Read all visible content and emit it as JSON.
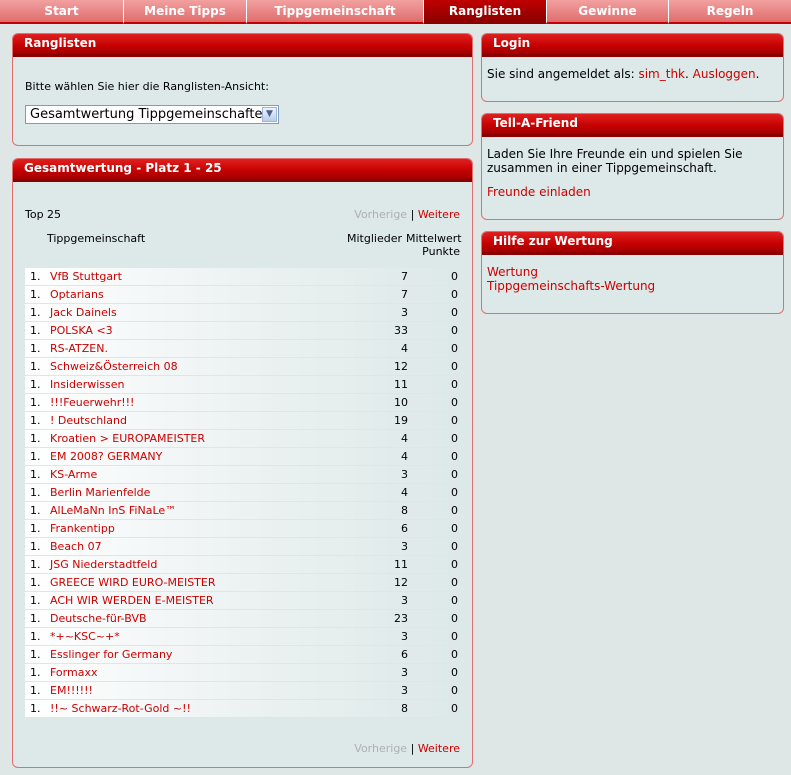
{
  "tabs": [
    {
      "label": "Start"
    },
    {
      "label": "Meine Tipps"
    },
    {
      "label": "Tippgemeinschaft"
    },
    {
      "label": "Ranglisten"
    },
    {
      "label": "Gewinne"
    },
    {
      "label": "Regeln"
    }
  ],
  "ranglisten": {
    "title": "Ranglisten",
    "instruction": "Bitte wählen Sie hier die Ranglisten-Ansicht:",
    "selected_view": "Gesamtwertung Tippgemeinschaften"
  },
  "ranking": {
    "title": "Gesamtwertung - Platz 1 - 25",
    "top_label": "Top 25",
    "prev_label": "Vorherige",
    "separator": "|",
    "next_label": "Weitere",
    "col_name": "Tippgemeinschaft",
    "col_members": "Mitglieder",
    "col_avg_line1": "Mittelwert",
    "col_avg_line2": "Punkte",
    "rows": [
      {
        "pos": "1.",
        "name": "VfB Stuttgart",
        "members": "7",
        "avg": "0"
      },
      {
        "pos": "1.",
        "name": "Optarians",
        "members": "7",
        "avg": "0"
      },
      {
        "pos": "1.",
        "name": "Jack Dainels",
        "members": "3",
        "avg": "0"
      },
      {
        "pos": "1.",
        "name": "POLSKA <3",
        "members": "33",
        "avg": "0"
      },
      {
        "pos": "1.",
        "name": "RS-ATZEN.",
        "members": "4",
        "avg": "0"
      },
      {
        "pos": "1.",
        "name": "Schweiz&Österreich 08",
        "members": "12",
        "avg": "0"
      },
      {
        "pos": "1.",
        "name": "Insiderwissen",
        "members": "11",
        "avg": "0"
      },
      {
        "pos": "1.",
        "name": "!!!Feuerwehr!!!",
        "members": "10",
        "avg": "0"
      },
      {
        "pos": "1.",
        "name": "! Deutschland",
        "members": "19",
        "avg": "0"
      },
      {
        "pos": "1.",
        "name": "Kroatien > EUROPAMEISTER",
        "members": "4",
        "avg": "0"
      },
      {
        "pos": "1.",
        "name": "EM 2008? GERMANY",
        "members": "4",
        "avg": "0"
      },
      {
        "pos": "1.",
        "name": "KS-Arme",
        "members": "3",
        "avg": "0"
      },
      {
        "pos": "1.",
        "name": "Berlin Marienfelde",
        "members": "4",
        "avg": "0"
      },
      {
        "pos": "1.",
        "name": "AlLeMaNn InS FiNaLe™",
        "members": "8",
        "avg": "0"
      },
      {
        "pos": "1.",
        "name": "Frankentipp",
        "members": "6",
        "avg": "0"
      },
      {
        "pos": "1.",
        "name": "Beach 07",
        "members": "3",
        "avg": "0"
      },
      {
        "pos": "1.",
        "name": "JSG Niederstadtfeld",
        "members": "11",
        "avg": "0"
      },
      {
        "pos": "1.",
        "name": "GREECE WIRD EURO-MEISTER",
        "members": "12",
        "avg": "0"
      },
      {
        "pos": "1.",
        "name": "ACH WIR WERDEN E-MEISTER",
        "members": "3",
        "avg": "0"
      },
      {
        "pos": "1.",
        "name": "Deutsche-für-BVB",
        "members": "23",
        "avg": "0"
      },
      {
        "pos": "1.",
        "name": "*+~KSC~+*",
        "members": "3",
        "avg": "0"
      },
      {
        "pos": "1.",
        "name": "Esslinger for Germany",
        "members": "6",
        "avg": "0"
      },
      {
        "pos": "1.",
        "name": "Formaxx",
        "members": "3",
        "avg": "0"
      },
      {
        "pos": "1.",
        "name": "EM!!!!!!",
        "members": "3",
        "avg": "0"
      },
      {
        "pos": "1.",
        "name": "!!~ Schwarz-Rot-Gold ~!!",
        "members": "8",
        "avg": "0"
      }
    ]
  },
  "login": {
    "title": "Login",
    "text": "Sie sind angemeldet als:",
    "username": "sim_thk",
    "dot1": ".",
    "logout": "Ausloggen",
    "dot2": "."
  },
  "tellafriend": {
    "title": "Tell-A-Friend",
    "text": "Laden Sie Ihre Freunde ein und spielen Sie zusammen in einer Tippgemeinschaft.",
    "link": "Freunde einladen"
  },
  "help": {
    "title": "Hilfe zur Wertung",
    "link1": "Wertung",
    "link2": "Tippgemeinschafts-Wertung"
  },
  "colors": {
    "accent": "#c40000",
    "link": "#cc0000",
    "panel_bg": "#dde8e8",
    "page_bg": "#dfe6e6"
  }
}
